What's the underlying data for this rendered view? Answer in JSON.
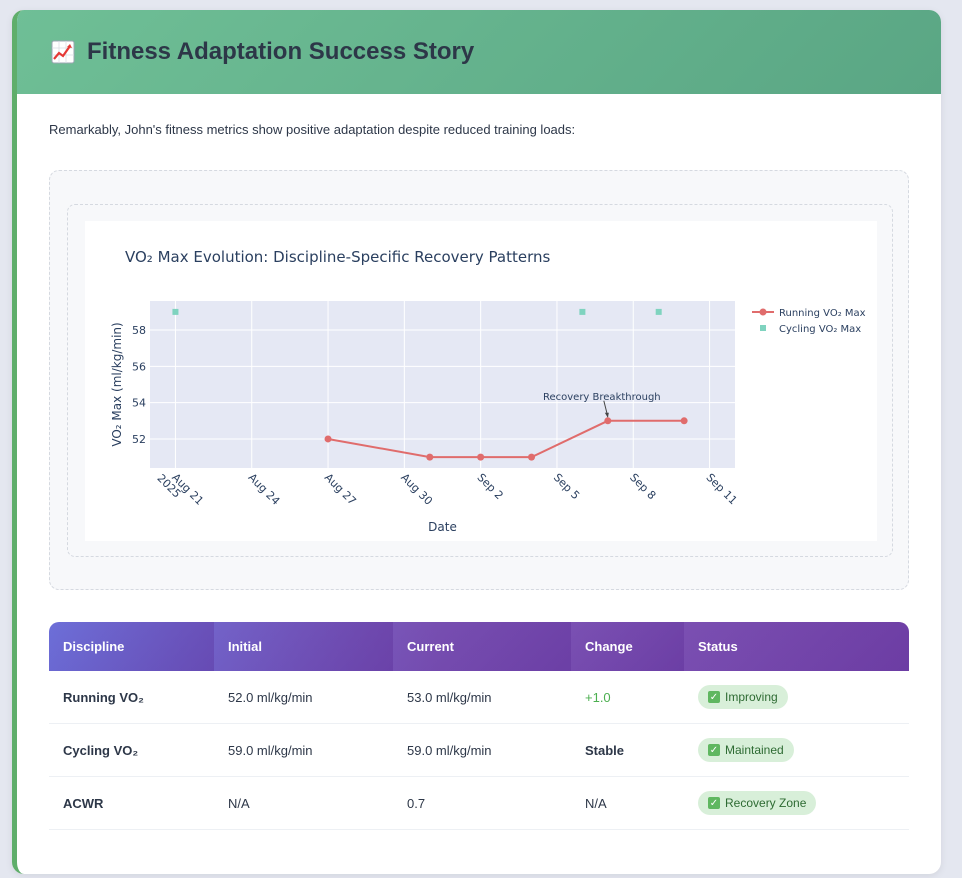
{
  "header": {
    "icon": "chart-increasing-icon",
    "title": "Fitness Adaptation Success Story"
  },
  "intro": "Remarkably, John's fitness metrics show positive adaptation despite reduced training loads:",
  "colors": {
    "running": "#e06c6c",
    "cycling": "#7fd3bf",
    "plot_bg": "#e5e8f4",
    "accent": "#5fae6b"
  },
  "chart_data": {
    "type": "line",
    "title": "VO₂ Max Evolution: Discipline-Specific Recovery Patterns",
    "xlabel": "Date",
    "ylabel": "VO₂ Max (ml/kg/min)",
    "x_ticks": [
      "Aug 21\n2025",
      "Aug 24",
      "Aug 27",
      "Aug 30",
      "Sep 2",
      "Sep 5",
      "Sep 8",
      "Sep 11"
    ],
    "y_ticks": [
      52,
      54,
      56,
      58
    ],
    "ylim": [
      50.4,
      59.6
    ],
    "xlim": [
      "2025-08-20",
      "2025-09-12"
    ],
    "legend_position": "top-right",
    "grid": true,
    "series": [
      {
        "name": "Running VO₂ Max",
        "mode": "lines+markers",
        "points": [
          {
            "x": "2025-08-27",
            "y": 52
          },
          {
            "x": "2025-08-31",
            "y": 51
          },
          {
            "x": "2025-09-02",
            "y": 51
          },
          {
            "x": "2025-09-04",
            "y": 51
          },
          {
            "x": "2025-09-07",
            "y": 53
          },
          {
            "x": "2025-09-10",
            "y": 53
          }
        ]
      },
      {
        "name": "Cycling VO₂ Max",
        "mode": "markers",
        "points": [
          {
            "x": "2025-08-21",
            "y": 59
          },
          {
            "x": "2025-09-06",
            "y": 59
          },
          {
            "x": "2025-09-09",
            "y": 59
          }
        ]
      }
    ],
    "annotations": [
      {
        "text": "Recovery Breakthrough",
        "x": "2025-09-07",
        "y": 53
      }
    ]
  },
  "table": {
    "headers": [
      "Discipline",
      "Initial",
      "Current",
      "Change",
      "Status"
    ],
    "rows": [
      {
        "discipline": "Running VO₂",
        "initial": "52.0 ml/kg/min",
        "current": "53.0 ml/kg/min",
        "change": "+1.0",
        "status": "Improving"
      },
      {
        "discipline": "Cycling VO₂",
        "initial": "59.0 ml/kg/min",
        "current": "59.0 ml/kg/min",
        "change": "Stable",
        "status": "Maintained"
      },
      {
        "discipline": "ACWR",
        "initial": "N/A",
        "current": "0.7",
        "change": "N/A",
        "status": "Recovery Zone"
      }
    ]
  }
}
